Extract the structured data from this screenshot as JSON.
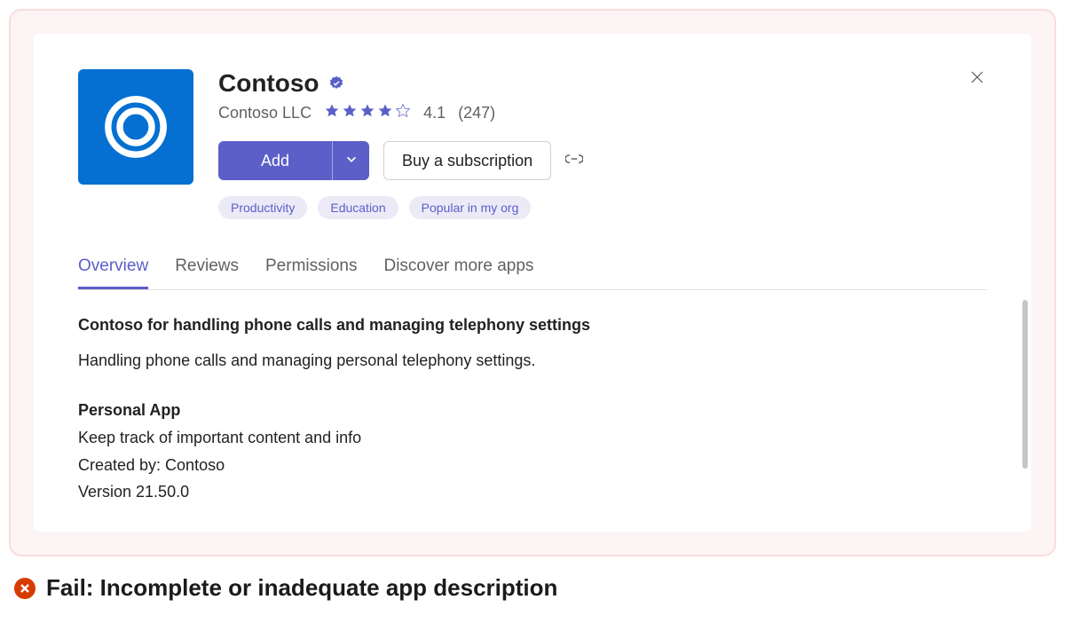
{
  "app": {
    "name": "Contoso",
    "publisher": "Contoso LLC",
    "rating_value": "4.1",
    "rating_count": "(247)",
    "stars_filled": 4,
    "stars_total": 5
  },
  "actions": {
    "add_label": "Add",
    "buy_label": "Buy a subscription"
  },
  "tags": [
    "Productivity",
    "Education",
    "Popular in my org"
  ],
  "tabs": [
    {
      "label": "Overview",
      "active": true
    },
    {
      "label": "Reviews",
      "active": false
    },
    {
      "label": "Permissions",
      "active": false
    },
    {
      "label": "Discover more apps",
      "active": false
    }
  ],
  "overview": {
    "headline": "Contoso for handling phone calls and managing telephony settings",
    "description": "Handling phone calls and managing personal telephony settings.",
    "section_title": "Personal App",
    "section_line1": "Keep track of important content and info",
    "section_line2": "Created by: Contoso",
    "section_line3": "Version 21.50.0"
  },
  "fail_message": "Fail: Incomplete or inadequate app description"
}
